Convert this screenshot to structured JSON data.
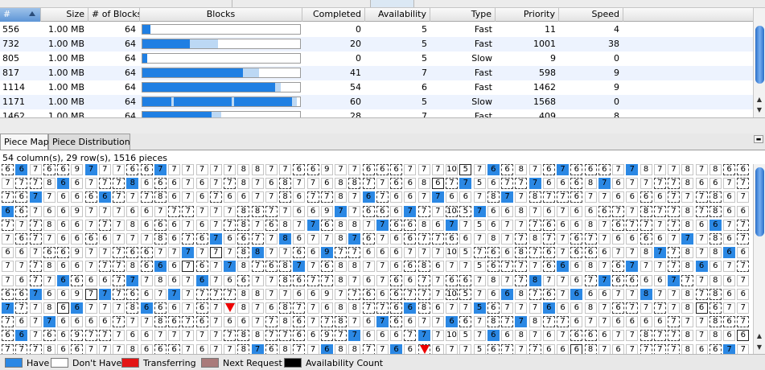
{
  "table": {
    "columns": [
      "#",
      "Size",
      "# of Blocks",
      "Blocks",
      "Completed",
      "Availability",
      "Type",
      "Priority",
      "Speed"
    ],
    "rows": [
      {
        "num": "556",
        "size": "1.00 MB",
        "blocks": "64",
        "completed": "0",
        "availability": "5",
        "type": "Fast",
        "priority": "11",
        "speed": "4",
        "done_fraction": 0.05,
        "pending_fraction": 0.0
      },
      {
        "num": "732",
        "size": "1.00 MB",
        "blocks": "64",
        "completed": "20",
        "availability": "5",
        "type": "Fast",
        "priority": "1001",
        "speed": "38",
        "done_fraction": 0.3,
        "pending_fraction": 0.18
      },
      {
        "num": "805",
        "size": "1.00 MB",
        "blocks": "64",
        "completed": "0",
        "availability": "5",
        "type": "Slow",
        "priority": "9",
        "speed": "0",
        "done_fraction": 0.03,
        "pending_fraction": 0.0
      },
      {
        "num": "817",
        "size": "1.00 MB",
        "blocks": "64",
        "completed": "41",
        "availability": "7",
        "type": "Fast",
        "priority": "598",
        "speed": "9",
        "done_fraction": 0.64,
        "pending_fraction": 0.1
      },
      {
        "num": "1114",
        "size": "1.00 MB",
        "blocks": "64",
        "completed": "54",
        "availability": "6",
        "type": "Fast",
        "priority": "1462",
        "speed": "9",
        "done_fraction": 0.84,
        "pending_fraction": 0.04
      },
      {
        "num": "1171",
        "size": "1.00 MB",
        "blocks": "64",
        "completed": "60",
        "availability": "5",
        "type": "Slow",
        "priority": "1568",
        "speed": "0",
        "done_fraction": 0.96,
        "pending_fraction": 0.02
      },
      {
        "num": "1462",
        "size": "1.00 MB",
        "blocks": "64",
        "completed": "28",
        "availability": "7",
        "type": "Fast",
        "priority": "409",
        "speed": "8",
        "done_fraction": 0.44,
        "pending_fraction": 0.06
      }
    ]
  },
  "tabs": [
    {
      "label": "Piece Map",
      "active": true
    },
    {
      "label": "Piece Distribution",
      "active": false
    }
  ],
  "piece_map": {
    "info": "54 column(s), 29 row(s), 1516 pieces",
    "visible_rows": [
      "6:6:7:6:6:9:7:7:7:6:6:7:7:7:7:7:7:8:8:7:7:6:6:9:7:7:6:6:6:7:7:7:10:5:7:6:6:8:7:6:7:6:6:6:7:7:8:7:7:8:7:8:6:6:7:6",
      "7:7:7:8:6:6:7:7:7:8:6:6:6:7:6:7:7:8:7:6:8:7:7:6:8:8:7:7:6:6:8:6:7:7:5:6:7:7:7:6:6:6:8:7:6:7",
      "7:6:7:7:6:6:6:6:7:7:7:8:6:7:6:7:6:6:7:7:8:6:7:7:8:7:6:7:6:6:7:7:6:6:7:8:7:7:8:7"
    ]
  },
  "legend": [
    {
      "label": "Have",
      "color": "#2b88e4"
    },
    {
      "label": "Don't Have",
      "color": "#ffffff"
    },
    {
      "label": "Transferring",
      "color": "#e31414"
    },
    {
      "label": "Next Request",
      "color": "#a97a7a"
    },
    {
      "label": "Availability Count",
      "color": "#000000"
    }
  ]
}
